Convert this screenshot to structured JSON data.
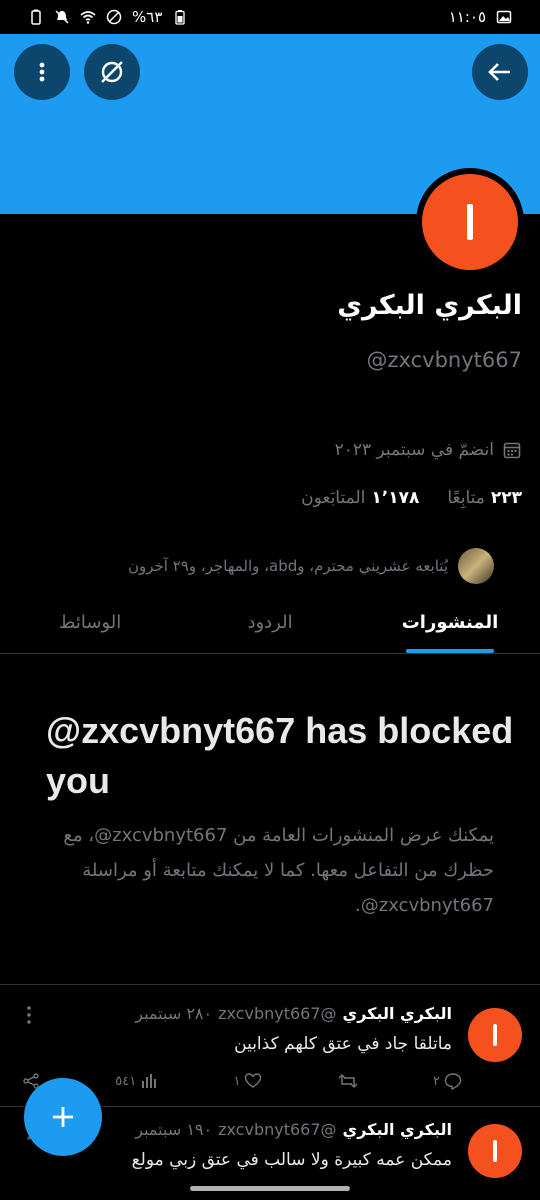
{
  "status_bar": {
    "battery": "%٦٣",
    "time": "١١:٠٥"
  },
  "header": {
    "buttons": [
      "back-arrow-icon",
      "hide-eye-icon",
      "more-vertical-icon"
    ]
  },
  "profile": {
    "name": "البكري البكري",
    "handle": "@zxcvbnyt667",
    "joined": "انضمّ في سبتمبر ٢٠٢٣",
    "following_count": "٢٢٣",
    "following_label": "متابِعًا",
    "followers_count": "١٬١٧٨",
    "followers_label": "المتابَعون",
    "followed_by": "يُتابعه عشريني محترم، وabd، والمهاجر، و٢٩ آخرون"
  },
  "tabs": [
    {
      "label": "المنشورات",
      "active": true
    },
    {
      "label": "الردود",
      "active": false
    },
    {
      "label": "الوسائط",
      "active": false
    }
  ],
  "blocked": {
    "title": "@zxcvbnyt667 has blocked you",
    "description": "يمكنك عرض المنشورات العامة من ‎@zxcvbnyt667، مع حظرك من التفاعل معها. كما لا يمكنك متابعة أو مراسلة ‎@zxcvbnyt667."
  },
  "tweets": [
    {
      "name": "البكري البكري",
      "handle": "@zxcvbnyt667",
      "time": "٢٨٠ سبتمبر",
      "text": "ماتلقا جاد في عتق كلهم كذابين",
      "replies": "٢",
      "retweets": "",
      "likes": "١",
      "views": "٥٤١"
    },
    {
      "name": "البكري البكري",
      "handle": "@zxcvbnyt667",
      "time": "١٩٠ سبتمبر",
      "text": "ممكن عمه كبيرة ولا سالب في عتق زبي مولع"
    }
  ],
  "colors": {
    "accent": "#1d9bf0",
    "avatar": "#f4511e",
    "muted": "#71767b"
  }
}
